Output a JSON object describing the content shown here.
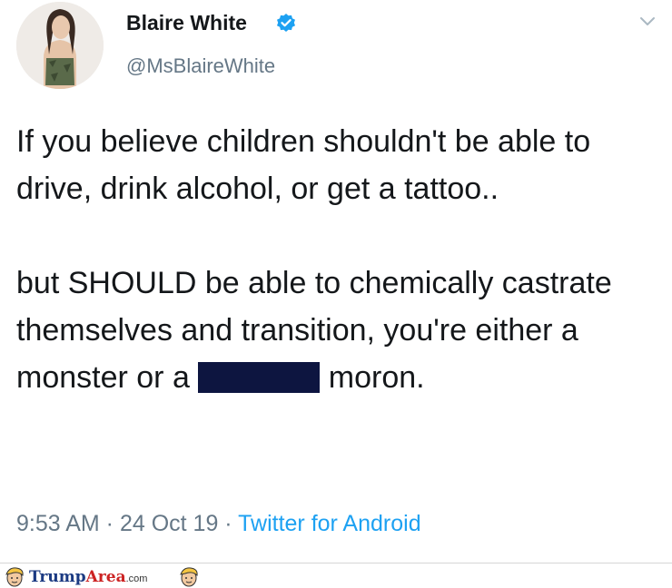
{
  "tweet": {
    "author": {
      "display_name": "Blaire White",
      "handle": "@MsBlaireWhite",
      "verified": true,
      "avatar_icon": "profile-photo"
    },
    "text": {
      "paragraph1": "If you believe children shouldn't be able to drive, drink alcohol, or get a tattoo..",
      "paragraph2_before": "but SHOULD be able to chemically castrate themselves and transition, you're either a monster or a",
      "paragraph2_after": "moron."
    },
    "timestamp": {
      "time": "9:53 AM",
      "separator": " · ",
      "date": "24 Oct 19",
      "source": "Twitter for Android"
    },
    "menu_icon": "chevron-down-icon"
  },
  "watermark": {
    "text_part1": "Trump",
    "text_part2": "Area",
    "text_part3": ".com",
    "icon": "trump-face-icon"
  },
  "colors": {
    "text": "#14171a",
    "secondary": "#657786",
    "link": "#1da1f2",
    "verified": "#1da1f2",
    "redaction": "#0d1540"
  }
}
